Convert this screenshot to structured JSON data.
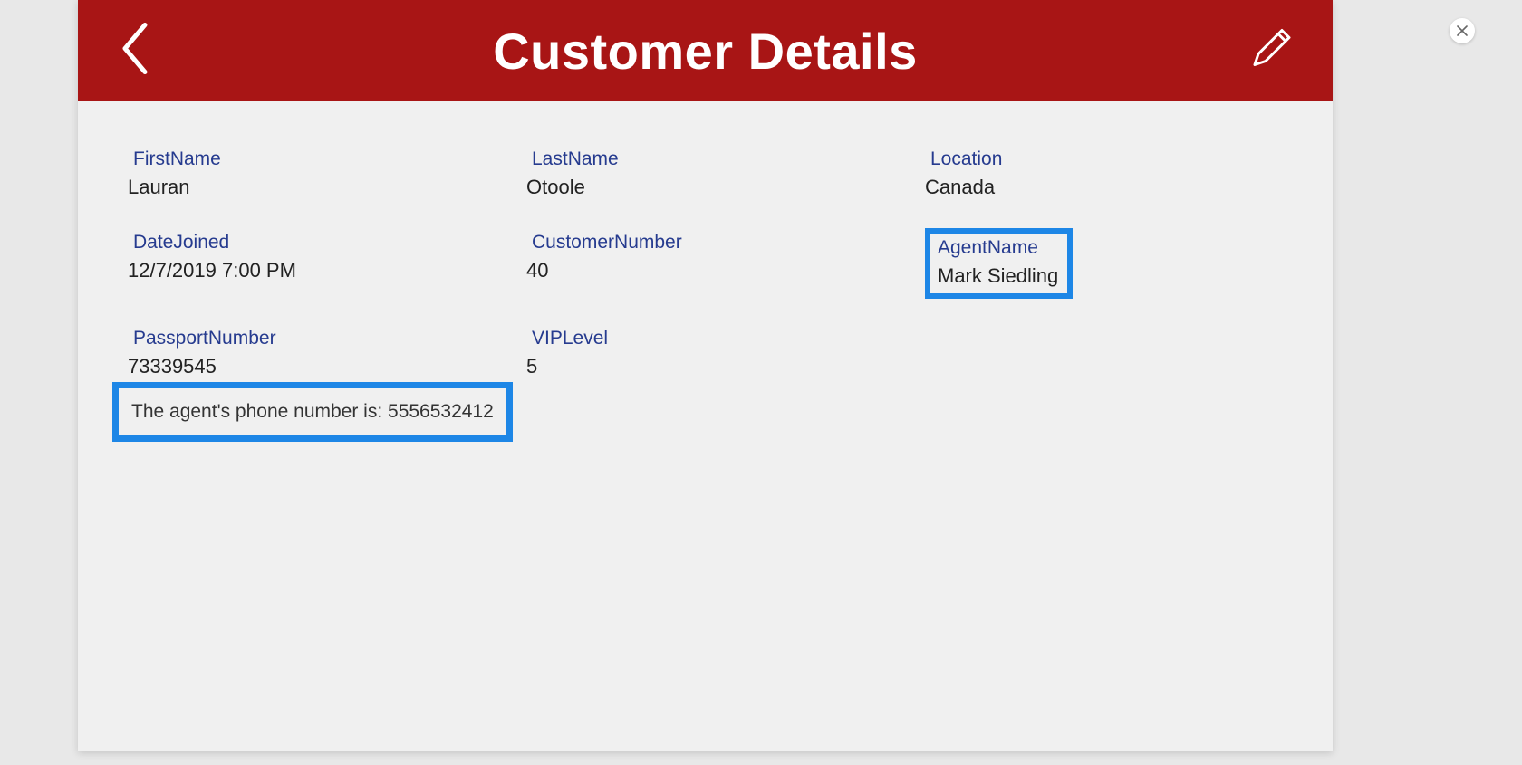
{
  "header": {
    "title": "Customer Details"
  },
  "fields": {
    "firstName": {
      "label": "FirstName",
      "value": "Lauran"
    },
    "lastName": {
      "label": "LastName",
      "value": "Otoole"
    },
    "location": {
      "label": "Location",
      "value": "Canada"
    },
    "dateJoined": {
      "label": "DateJoined",
      "value": "12/7/2019 7:00 PM"
    },
    "customerNumber": {
      "label": "CustomerNumber",
      "value": "40"
    },
    "agentName": {
      "label": "AgentName",
      "value": "Mark Siedling"
    },
    "passportNumber": {
      "label": "PassportNumber",
      "value": "73339545"
    },
    "vipLevel": {
      "label": "VIPLevel",
      "value": "5"
    }
  },
  "note": {
    "text": "The agent's phone number is: 5556532412"
  }
}
